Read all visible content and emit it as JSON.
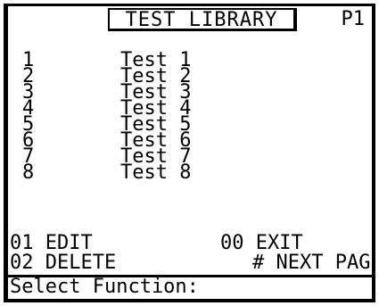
{
  "header": {
    "title": "TEST LIBRARY",
    "page": "P1"
  },
  "list": {
    "items": [
      {
        "number": "1",
        "name": "Test 1"
      },
      {
        "number": "2",
        "name": "Test 2"
      },
      {
        "number": "3",
        "name": "Test 3"
      },
      {
        "number": "4",
        "name": "Test 4"
      },
      {
        "number": "5",
        "name": "Test 5"
      },
      {
        "number": "6",
        "name": "Test 6"
      },
      {
        "number": "7",
        "name": "Test 7"
      },
      {
        "number": "8",
        "name": "Test 8"
      }
    ]
  },
  "footer": {
    "edit": "01 EDIT",
    "delete": "02 DELETE",
    "exit": "00 EXIT",
    "next_page": "# NEXT PAGE",
    "prompt": "Select Function:"
  }
}
